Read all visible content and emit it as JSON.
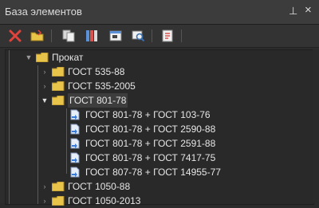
{
  "panel": {
    "title": "База элементов",
    "pin_glyph": "⊥",
    "close_glyph": "×"
  },
  "toolbar": {
    "buttons": [
      {
        "name": "delete-icon",
        "color": "#e0433b"
      },
      {
        "name": "open-folder-icon",
        "color": "#e8c547"
      },
      {
        "name": "copy-icon",
        "color": "#c8c8c8"
      },
      {
        "name": "properties-icon",
        "color": "#c8c8c8"
      },
      {
        "name": "window-icon",
        "color": "#c8c8c8"
      },
      {
        "name": "search-icon",
        "color": "#c8c8c8"
      },
      {
        "name": "report-icon",
        "color": "#d9534f"
      }
    ]
  },
  "tree": {
    "root": "Прокат",
    "items": [
      "ГОСТ 535-88",
      "ГОСТ 535-2005",
      "ГОСТ 801-78",
      "ГОСТ 1050-88",
      "ГОСТ 1050-2013"
    ],
    "children": [
      "ГОСТ 801-78 + ГОСТ 103-76",
      "ГОСТ 801-78 + ГОСТ 2590-88",
      "ГОСТ 801-78 + ГОСТ 2591-88",
      "ГОСТ 801-78 + ГОСТ 7417-75",
      "ГОСТ 807-78 + ГОСТ 14955-77"
    ]
  }
}
